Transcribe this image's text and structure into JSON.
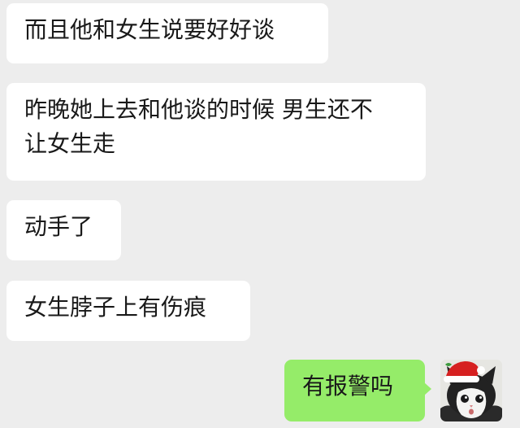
{
  "chat": {
    "messages": [
      {
        "sender": "other",
        "text": "而且他和女生说要好好谈"
      },
      {
        "sender": "other",
        "lines": [
          "昨晚她上去和他谈的时候 男生还不",
          "让女生走"
        ]
      },
      {
        "sender": "other",
        "text": "动手了"
      },
      {
        "sender": "other",
        "text": "女生脖子上有伤痕"
      },
      {
        "sender": "me",
        "text": "有报警吗"
      }
    ]
  },
  "colors": {
    "background": "#ededed",
    "bubble_other": "#ffffff",
    "bubble_me": "#95ec69",
    "text": "#191919"
  },
  "avatar": {
    "icon": "cat-with-santa-hat-icon"
  }
}
